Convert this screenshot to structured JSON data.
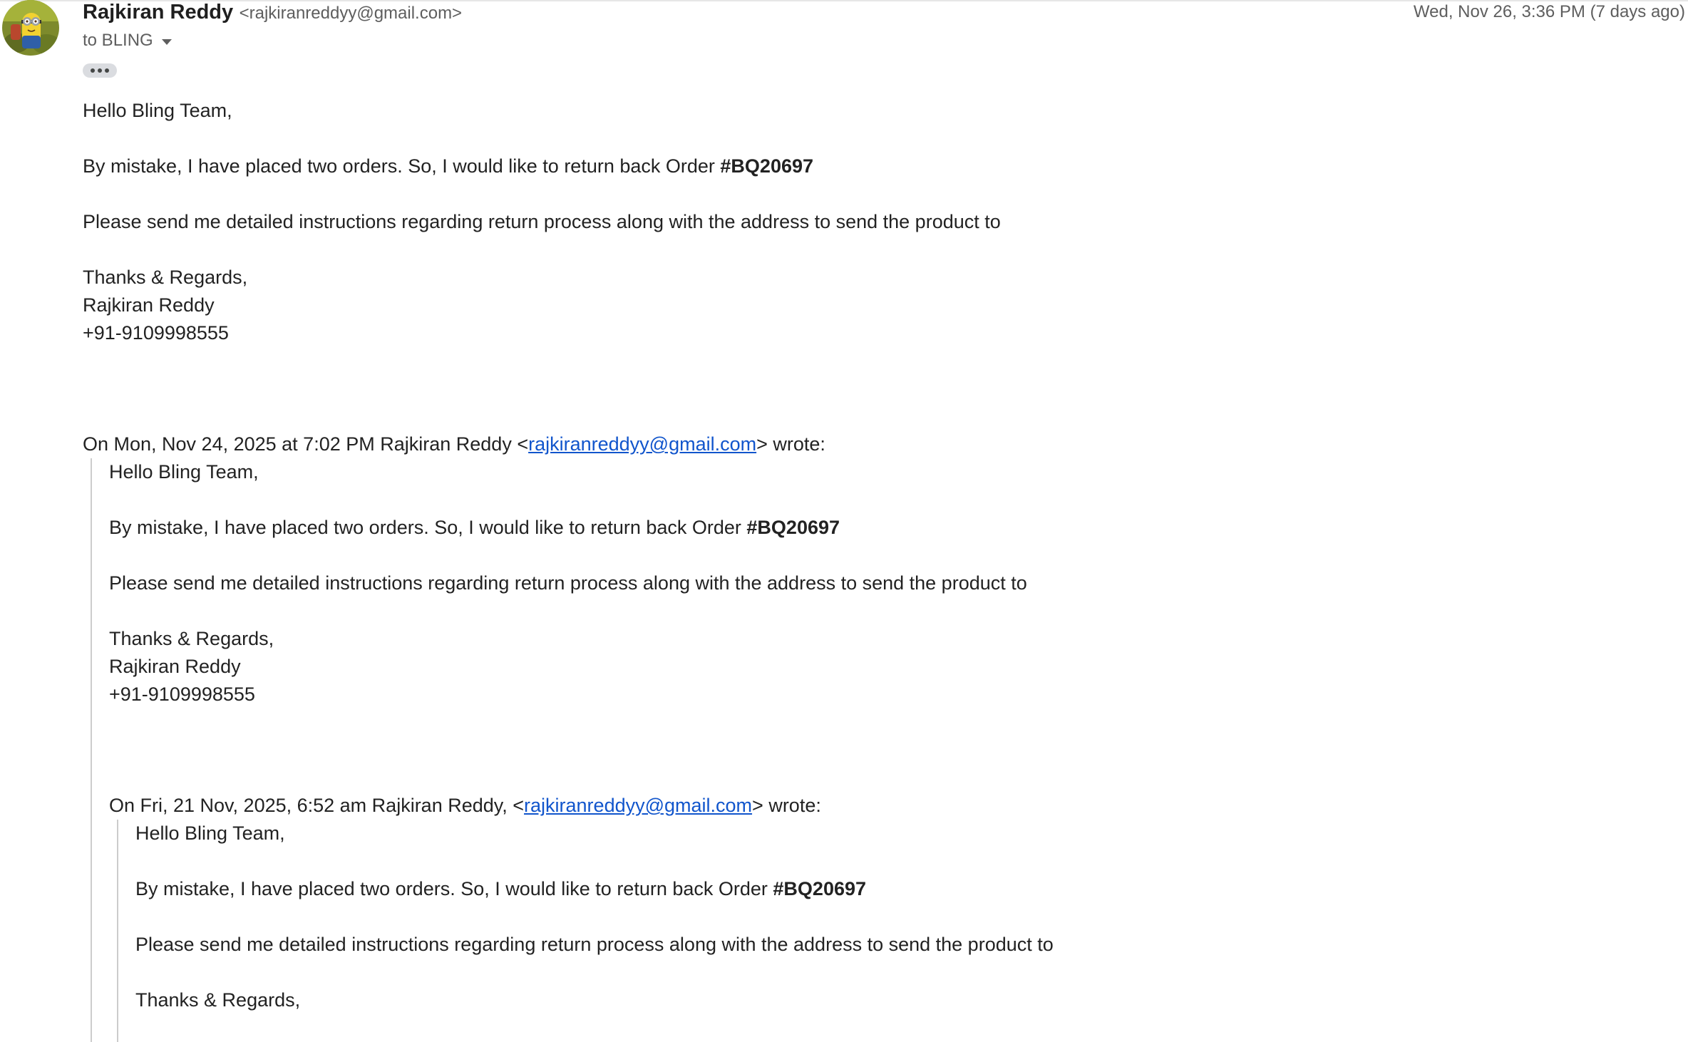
{
  "header": {
    "sender_name": "Rajkiran Reddy",
    "sender_email": "<rajkiranreddyy@gmail.com>",
    "date": "Wed, Nov 26, 3:36 PM (7 days ago)",
    "to_label": "to BLING",
    "show_trimmed_icon": "ellipsis-icon"
  },
  "message": {
    "greeting": "Hello Bling Team,",
    "line1_prefix": "By mistake, I have placed two orders. So, I would like to return back Order ",
    "order_number": "#BQ20697",
    "line2": "Please send me detailed instructions regarding return process along with the address to send the product to",
    "closing": "Thanks & Regards,",
    "signature_name": "Rajkiran Reddy",
    "signature_phone": "+91-9109998555"
  },
  "quote1": {
    "attribution_prefix": "On Mon, Nov 24, 2025 at 7:02 PM Rajkiran Reddy <",
    "attribution_email": "rajkiranreddyy@gmail.com",
    "attribution_suffix": "> wrote:",
    "greeting": "Hello Bling Team,",
    "line1_prefix": "By mistake, I have placed two orders. So, I would like to return back Order ",
    "order_number": "#BQ20697",
    "line2": "Please send me detailed instructions regarding return process along with the address to send the product to",
    "closing": "Thanks & Regards,",
    "signature_name": "Rajkiran Reddy",
    "signature_phone": "+91-9109998555"
  },
  "quote2": {
    "attribution_prefix": "On Fri, 21 Nov, 2025, 6:52 am Rajkiran Reddy, <",
    "attribution_email": "rajkiranreddyy@gmail.com",
    "attribution_suffix": "> wrote:",
    "greeting": "Hello Bling Team,",
    "line1_prefix": "By mistake, I have placed two orders. So, I would like to return back Order ",
    "order_number": "#BQ20697",
    "line2": "Please send me detailed instructions regarding return process along with the address to send the product to",
    "closing": "Thanks & Regards,"
  },
  "colors": {
    "link": "#1155cc",
    "quote_border": "#cccccc",
    "muted_text": "#5e5e5e"
  }
}
